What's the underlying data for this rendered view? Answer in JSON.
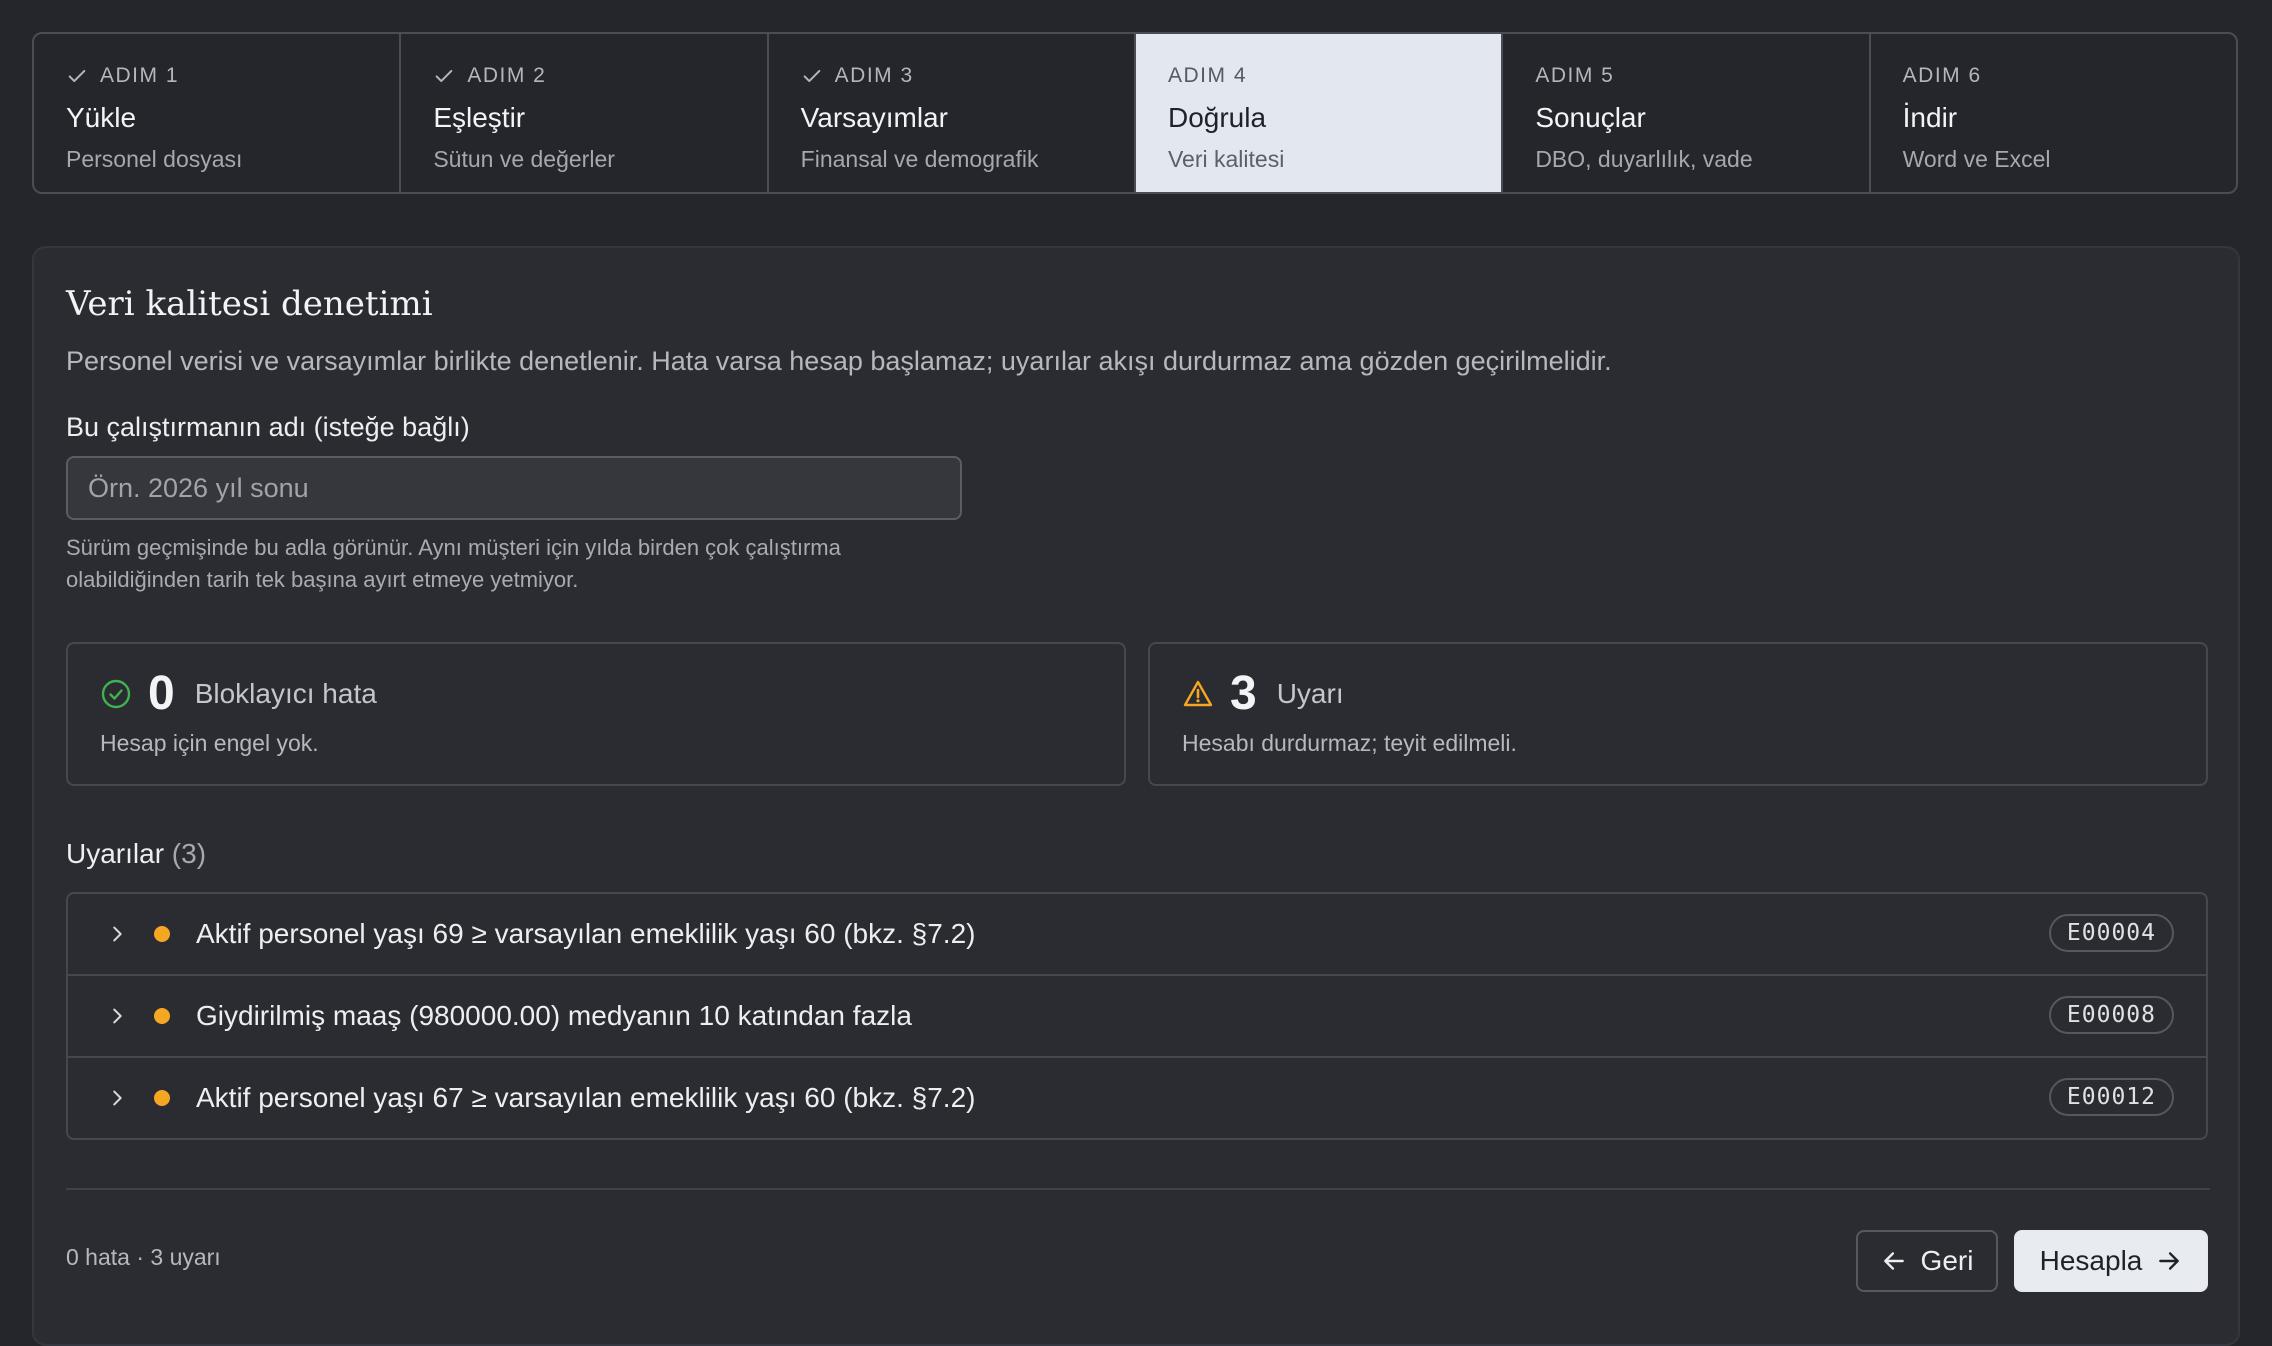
{
  "stepper": {
    "steps": [
      {
        "number": "ADIM 1",
        "title": "Yükle",
        "subtitle": "Personel dosyası",
        "state": "done"
      },
      {
        "number": "ADIM 2",
        "title": "Eşleştir",
        "subtitle": "Sütun ve değerler",
        "state": "done"
      },
      {
        "number": "ADIM 3",
        "title": "Varsayımlar",
        "subtitle": "Finansal ve demografik",
        "state": "done"
      },
      {
        "number": "ADIM 4",
        "title": "Doğrula",
        "subtitle": "Veri kalitesi",
        "state": "active"
      },
      {
        "number": "ADIM 5",
        "title": "Sonuçlar",
        "subtitle": "DBO, duyarlılık, vade",
        "state": "pending"
      },
      {
        "number": "ADIM 6",
        "title": "İndir",
        "subtitle": "Word ve Excel",
        "state": "pending"
      }
    ]
  },
  "main": {
    "title": "Veri kalitesi denetimi",
    "description": "Personel verisi ve varsayımlar birlikte denetlenir. Hata varsa hesap başlamaz; uyarılar akışı durdurmaz ama gözden geçirilmelidir.",
    "run_name": {
      "label": "Bu çalıştırmanın adı (isteğe bağlı)",
      "placeholder": "Örn. 2026 yıl sonu",
      "value": "",
      "help": "Sürüm geçmişinde bu adla görünür. Aynı müşteri için yılda birden çok çalıştırma olabildiğinden tarih tek başına ayırt etmeye yetmiyor."
    },
    "summary": {
      "errors": {
        "count": "0",
        "label": "Bloklayıcı hata",
        "note": "Hesap için engel yok.",
        "icon": "check-circle-icon",
        "color": "#3fb34f"
      },
      "warnings": {
        "count": "3",
        "label": "Uyarı",
        "note": "Hesabı durdurmaz; teyit edilmeli.",
        "icon": "warning-triangle-icon",
        "color": "#f5a623"
      }
    },
    "warnings_heading": "Uyarılar",
    "warnings_count": "(3)",
    "warnings": [
      {
        "text": "Aktif personel yaşı 69 ≥ varsayılan emeklilik yaşı 60 (bkz. §7.2)",
        "code": "E00004"
      },
      {
        "text": "Giydirilmiş maaş (980000.00) medyanın 10 katından fazla",
        "code": "E00008"
      },
      {
        "text": "Aktif personel yaşı 67 ≥ varsayılan emeklilik yaşı 60 (bkz. §7.2)",
        "code": "E00012"
      }
    ]
  },
  "footer": {
    "status": "0 hata · 3 uyarı",
    "back_label": "Geri",
    "calc_label": "Hesapla"
  },
  "colors": {
    "background": "#24262b",
    "active_step": "#e3e7ee",
    "warning_dot": "#f5a623",
    "ok_green": "#3fb34f"
  }
}
